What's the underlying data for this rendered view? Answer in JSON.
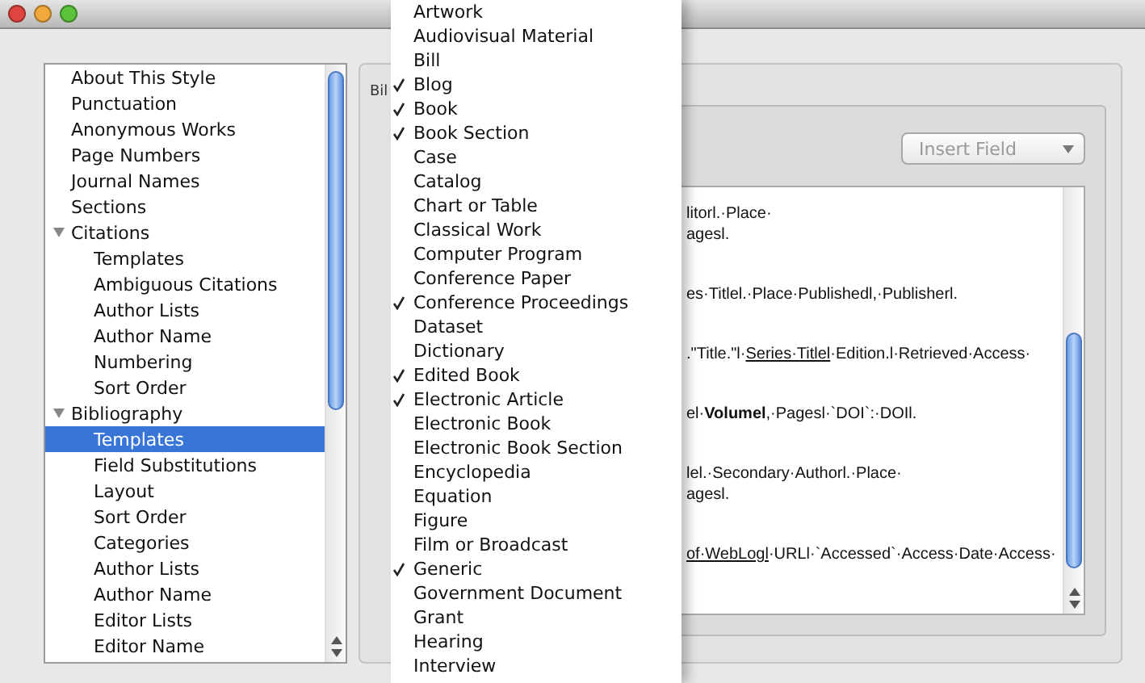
{
  "sidebar": {
    "items": [
      {
        "label": "About This Style",
        "selected": false
      },
      {
        "label": "Punctuation",
        "selected": false
      },
      {
        "label": "Anonymous Works",
        "selected": false
      },
      {
        "label": "Page Numbers",
        "selected": false
      },
      {
        "label": "Journal Names",
        "selected": false
      },
      {
        "label": "Sections",
        "selected": false
      },
      {
        "label": "Citations",
        "selected": false,
        "expanded": true,
        "children": [
          {
            "label": "Templates",
            "selected": false
          },
          {
            "label": "Ambiguous Citations",
            "selected": false
          },
          {
            "label": "Author Lists",
            "selected": false
          },
          {
            "label": "Author Name",
            "selected": false
          },
          {
            "label": "Numbering",
            "selected": false
          },
          {
            "label": "Sort Order",
            "selected": false
          }
        ]
      },
      {
        "label": "Bibliography",
        "selected": false,
        "expanded": true,
        "children": [
          {
            "label": "Templates",
            "selected": true
          },
          {
            "label": "Field Substitutions",
            "selected": false
          },
          {
            "label": "Layout",
            "selected": false
          },
          {
            "label": "Sort Order",
            "selected": false
          },
          {
            "label": "Categories",
            "selected": false
          },
          {
            "label": "Author Lists",
            "selected": false
          },
          {
            "label": "Author Name",
            "selected": false
          },
          {
            "label": "Editor Lists",
            "selected": false
          },
          {
            "label": "Editor Name",
            "selected": false
          }
        ]
      }
    ]
  },
  "panel": {
    "group_label": "Bil",
    "insert_field": "Insert Field",
    "template_lines": [
      [
        [
          {
            "text": "litorl.·Place·",
            "kind": "plain"
          }
        ],
        [
          {
            "text": "agesl.",
            "kind": "plain"
          }
        ]
      ],
      [
        [
          {
            "text": "es·Titlel.·Place·Publishedl,·Publisherl.",
            "kind": "plain"
          }
        ]
      ],
      [
        [
          {
            "text": ".\"Title.\"l·",
            "kind": "plain"
          },
          {
            "text": "Series·Titlel",
            "kind": "underline"
          },
          {
            "text": "·Edition.l·Retrieved·Access·",
            "kind": "plain"
          }
        ]
      ],
      [
        [
          {
            "text": "el·",
            "kind": "plain"
          },
          {
            "text": "Volumel",
            "kind": "bold"
          },
          {
            "text": ",·Pagesl·`DOI`:·DOIl.",
            "kind": "plain"
          }
        ]
      ],
      [
        [
          {
            "text": "lel.·Secondary·Authorl.·Place·",
            "kind": "plain"
          }
        ],
        [
          {
            "text": "agesl.",
            "kind": "plain"
          }
        ]
      ],
      [
        [
          {
            "text": "of·WebLogl",
            "kind": "underline"
          },
          {
            "text": "·URLl·`Accessed`·Access·Date·Access·",
            "kind": "plain"
          }
        ]
      ]
    ]
  },
  "menu": {
    "items": [
      {
        "label": "Artwork",
        "checked": false
      },
      {
        "label": "Audiovisual Material",
        "checked": false
      },
      {
        "label": "Bill",
        "checked": false
      },
      {
        "label": "Blog",
        "checked": true
      },
      {
        "label": "Book",
        "checked": true
      },
      {
        "label": "Book Section",
        "checked": true
      },
      {
        "label": "Case",
        "checked": false
      },
      {
        "label": "Catalog",
        "checked": false
      },
      {
        "label": "Chart or Table",
        "checked": false
      },
      {
        "label": "Classical Work",
        "checked": false
      },
      {
        "label": "Computer Program",
        "checked": false
      },
      {
        "label": "Conference Paper",
        "checked": false
      },
      {
        "label": "Conference Proceedings",
        "checked": true
      },
      {
        "label": "Dataset",
        "checked": false
      },
      {
        "label": "Dictionary",
        "checked": false
      },
      {
        "label": "Edited Book",
        "checked": true
      },
      {
        "label": "Electronic Article",
        "checked": true
      },
      {
        "label": "Electronic Book",
        "checked": false
      },
      {
        "label": "Electronic Book Section",
        "checked": false
      },
      {
        "label": "Encyclopedia",
        "checked": false
      },
      {
        "label": "Equation",
        "checked": false
      },
      {
        "label": "Figure",
        "checked": false
      },
      {
        "label": "Film or Broadcast",
        "checked": false
      },
      {
        "label": "Generic",
        "checked": true
      },
      {
        "label": "Government Document",
        "checked": false
      },
      {
        "label": "Grant",
        "checked": false
      },
      {
        "label": "Hearing",
        "checked": false
      },
      {
        "label": "Interview",
        "checked": false
      }
    ]
  }
}
